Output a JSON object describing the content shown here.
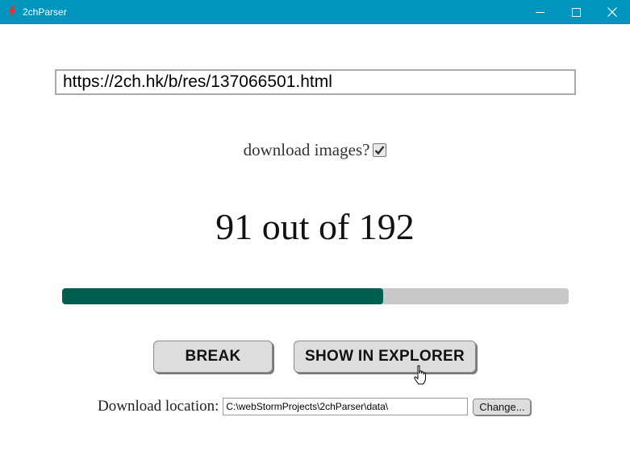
{
  "window": {
    "title": "2chParser",
    "icon": "lightning-icon",
    "controls": [
      "minimize-icon",
      "maximize-icon",
      "close-icon"
    ],
    "titlebar_color": "#0095be"
  },
  "url": {
    "value": "https://2ch.hk/b/res/137066501.html"
  },
  "download_images": {
    "label": "download images?",
    "checked": true
  },
  "progress": {
    "current": "91",
    "separator": " out of ",
    "total": "192",
    "fraction": 0.634,
    "fill_color": "#006050",
    "track_color": "#c8c8c8"
  },
  "buttons": {
    "break_label": "BREAK",
    "explorer_label": "SHOW IN EXPLORER"
  },
  "location": {
    "label": "Download location:",
    "value": "C:\\webStormProjects\\2chParser\\data\\",
    "change_label": "Change..."
  }
}
